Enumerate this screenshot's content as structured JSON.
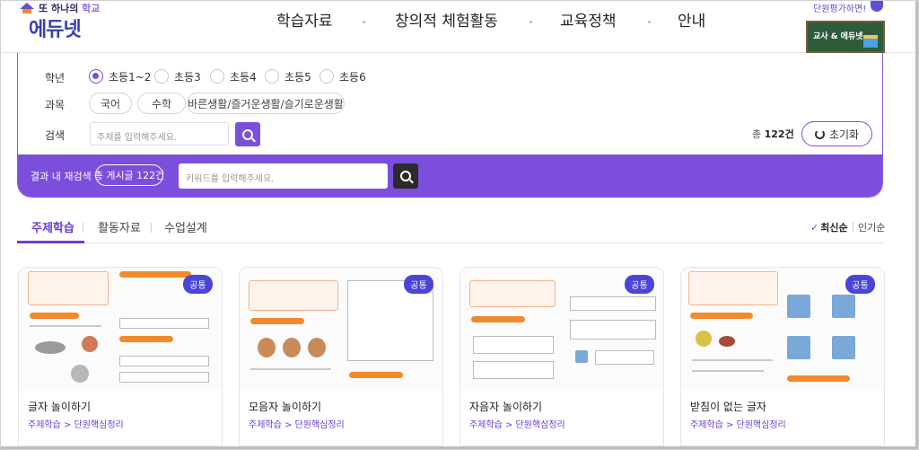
{
  "header": {
    "logo_sub_prefix": "또 하나의 ",
    "logo_sub_highlight": "학교",
    "logo_main": "에듀넷",
    "nav": [
      "학습자료",
      "창의적 체험활동",
      "교육정책",
      "안내"
    ],
    "banner_top": "단원평가하면!",
    "banner_text": "교사 & 에듀넷"
  },
  "filter": {
    "grade_label": "학년",
    "grades": [
      {
        "label": "초등1~2",
        "selected": true
      },
      {
        "label": "초등3",
        "selected": false
      },
      {
        "label": "초등4",
        "selected": false
      },
      {
        "label": "초등5",
        "selected": false
      },
      {
        "label": "초등6",
        "selected": false
      }
    ],
    "subject_label": "과목",
    "subjects": [
      "국어",
      "수학",
      "바른생활/즐거운생활/슬기로운생활"
    ],
    "search_label": "검색",
    "search_placeholder": "주제를 입력해주세요.",
    "total_prefix": "총",
    "total_value": "122건",
    "reset_label": "초기화",
    "refine_label": "결과 내 재검색",
    "refine_count": "총 게시글 122건",
    "refine_placeholder": "키워드를 입력해주세요."
  },
  "tabs": [
    "주제학습",
    "활동자료",
    "수업설계"
  ],
  "sort": {
    "latest": "최신순",
    "popular": "인기순"
  },
  "cards": [
    {
      "badge": "공통",
      "title": "글자 놀이하기",
      "path": "주제학습 > 단원핵심정리"
    },
    {
      "badge": "공통",
      "title": "모음자 놀이하기",
      "path": "주제학습 > 단원핵심정리"
    },
    {
      "badge": "공통",
      "title": "자음자 놀이하기",
      "path": "주제학습 > 단원핵심정리"
    },
    {
      "badge": "공통",
      "title": "받침이 없는 글자",
      "path": "주제학습 > 단원핵심정리"
    }
  ],
  "colors": {
    "accent": "#7b4fdc",
    "badge": "#4a45d8",
    "dark_button": "#2b2b2b"
  }
}
